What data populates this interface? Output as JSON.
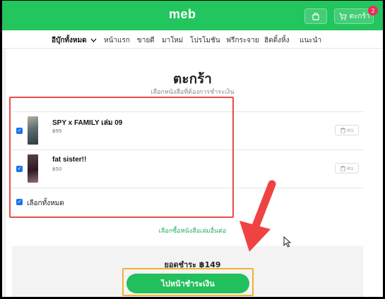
{
  "header": {
    "logo": "meb",
    "cart_label": "ตะกร้า",
    "cart_count": "2"
  },
  "nav": {
    "all_categories": "อีบุ๊กทั้งหมด",
    "items": [
      "หน้าแรก",
      "ขายดี",
      "มาใหม่",
      "โปรโมชัน",
      "ฟรีกระจาย",
      "ฮิตติ้งหิ้ง",
      "แนะนำ"
    ]
  },
  "page": {
    "title": "ตะกร้า",
    "subtitle": "เลือกหนังสือที่ต้องการชำระเงิน"
  },
  "cart_items": [
    {
      "title": "SPY x FAMILY เล่ม 09",
      "price": "฿99",
      "delete_label": "ลบ",
      "checked": true
    },
    {
      "title": "fat sister!!",
      "price": "฿50",
      "delete_label": "ลบ",
      "checked": true
    }
  ],
  "select_all_label": "เลือกทั้งหมด",
  "more_link": "เลือกซื้อหนังสือเล่มอื่นต่อ",
  "summary": {
    "total_label": "ยอดชำระ ฿149",
    "pay_button": "ไปหน้าชำระเงิน"
  },
  "colors": {
    "brand_green": "#23c55e",
    "annotation_red": "#e74c4c",
    "annotation_orange": "#f2b230",
    "badge": "#e8305a"
  },
  "icons": {
    "shop": "shopping-bag-icon",
    "cart": "cart-icon",
    "nav_dropdown": "chevron-down-icon",
    "delete": "trash-icon",
    "checkbox": "checkbox-checked-icon"
  }
}
